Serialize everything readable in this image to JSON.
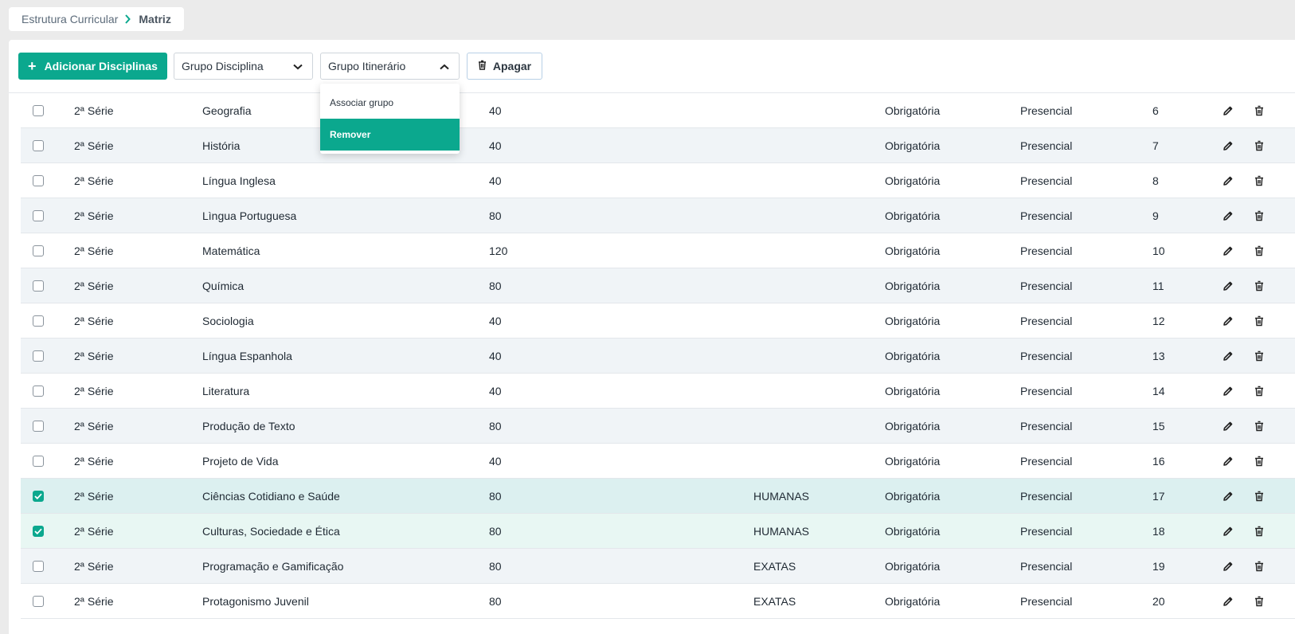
{
  "breadcrumb": {
    "parent": "Estrutura Curricular",
    "current": "Matriz"
  },
  "toolbar": {
    "add_label": "Adicionar Disciplinas",
    "group_discipline_label": "Grupo Disciplina",
    "group_itinerary_label": "Grupo Itinerário",
    "delete_label": "Apagar"
  },
  "dropdown": {
    "items": [
      "Associar grupo",
      "Remover"
    ],
    "active": "Remover"
  },
  "colors": {
    "accent": "#0ba88e",
    "row_alt": "#f0f4f7",
    "row_selected": "#dcf0f0"
  },
  "icons": {
    "add": "plus-icon",
    "dropdown": "chevron-down-icon",
    "dropdown_open": "chevron-up-icon",
    "delete": "trash-icon",
    "edit": "pencil-icon",
    "checked": "check-icon"
  },
  "rows": [
    {
      "serie": "2ª Série",
      "disciplina": "Geografia",
      "carga": "40",
      "grupo": "",
      "tipo": "Obrigatória",
      "modalidade": "Presencial",
      "ordem": "6",
      "checked": false
    },
    {
      "serie": "2ª Série",
      "disciplina": "História",
      "carga": "40",
      "grupo": "",
      "tipo": "Obrigatória",
      "modalidade": "Presencial",
      "ordem": "7",
      "checked": false
    },
    {
      "serie": "2ª Série",
      "disciplina": "Língua Inglesa",
      "carga": "40",
      "grupo": "",
      "tipo": "Obrigatória",
      "modalidade": "Presencial",
      "ordem": "8",
      "checked": false
    },
    {
      "serie": "2ª Série",
      "disciplina": "Lìngua Portuguesa",
      "carga": "80",
      "grupo": "",
      "tipo": "Obrigatória",
      "modalidade": "Presencial",
      "ordem": "9",
      "checked": false
    },
    {
      "serie": "2ª Série",
      "disciplina": "Matemática",
      "carga": "120",
      "grupo": "",
      "tipo": "Obrigatória",
      "modalidade": "Presencial",
      "ordem": "10",
      "checked": false
    },
    {
      "serie": "2ª Série",
      "disciplina": "Química",
      "carga": "80",
      "grupo": "",
      "tipo": "Obrigatória",
      "modalidade": "Presencial",
      "ordem": "11",
      "checked": false
    },
    {
      "serie": "2ª Série",
      "disciplina": "Sociologia",
      "carga": "40",
      "grupo": "",
      "tipo": "Obrigatória",
      "modalidade": "Presencial",
      "ordem": "12",
      "checked": false
    },
    {
      "serie": "2ª Série",
      "disciplina": "Língua Espanhola",
      "carga": "40",
      "grupo": "",
      "tipo": "Obrigatória",
      "modalidade": "Presencial",
      "ordem": "13",
      "checked": false
    },
    {
      "serie": "2ª Série",
      "disciplina": "Literatura",
      "carga": "40",
      "grupo": "",
      "tipo": "Obrigatória",
      "modalidade": "Presencial",
      "ordem": "14",
      "checked": false
    },
    {
      "serie": "2ª Série",
      "disciplina": "Produção de Texto",
      "carga": "80",
      "grupo": "",
      "tipo": "Obrigatória",
      "modalidade": "Presencial",
      "ordem": "15",
      "checked": false
    },
    {
      "serie": "2ª Série",
      "disciplina": "Projeto de Vida",
      "carga": "40",
      "grupo": "",
      "tipo": "Obrigatória",
      "modalidade": "Presencial",
      "ordem": "16",
      "checked": false
    },
    {
      "serie": "2ª Série",
      "disciplina": "Ciências Cotidiano e Saúde",
      "carga": "80",
      "grupo": "HUMANAS",
      "tipo": "Obrigatória",
      "modalidade": "Presencial",
      "ordem": "17",
      "checked": true
    },
    {
      "serie": "2ª Série",
      "disciplina": "Culturas, Sociedade e Ética",
      "carga": "80",
      "grupo": "HUMANAS",
      "tipo": "Obrigatória",
      "modalidade": "Presencial",
      "ordem": "18",
      "checked": true
    },
    {
      "serie": "2ª Série",
      "disciplina": "Programação e Gamificação",
      "carga": "80",
      "grupo": "EXATAS",
      "tipo": "Obrigatória",
      "modalidade": "Presencial",
      "ordem": "19",
      "checked": false
    },
    {
      "serie": "2ª Série",
      "disciplina": "Protagonismo Juvenil",
      "carga": "80",
      "grupo": "EXATAS",
      "tipo": "Obrigatória",
      "modalidade": "Presencial",
      "ordem": "20",
      "checked": false
    }
  ]
}
